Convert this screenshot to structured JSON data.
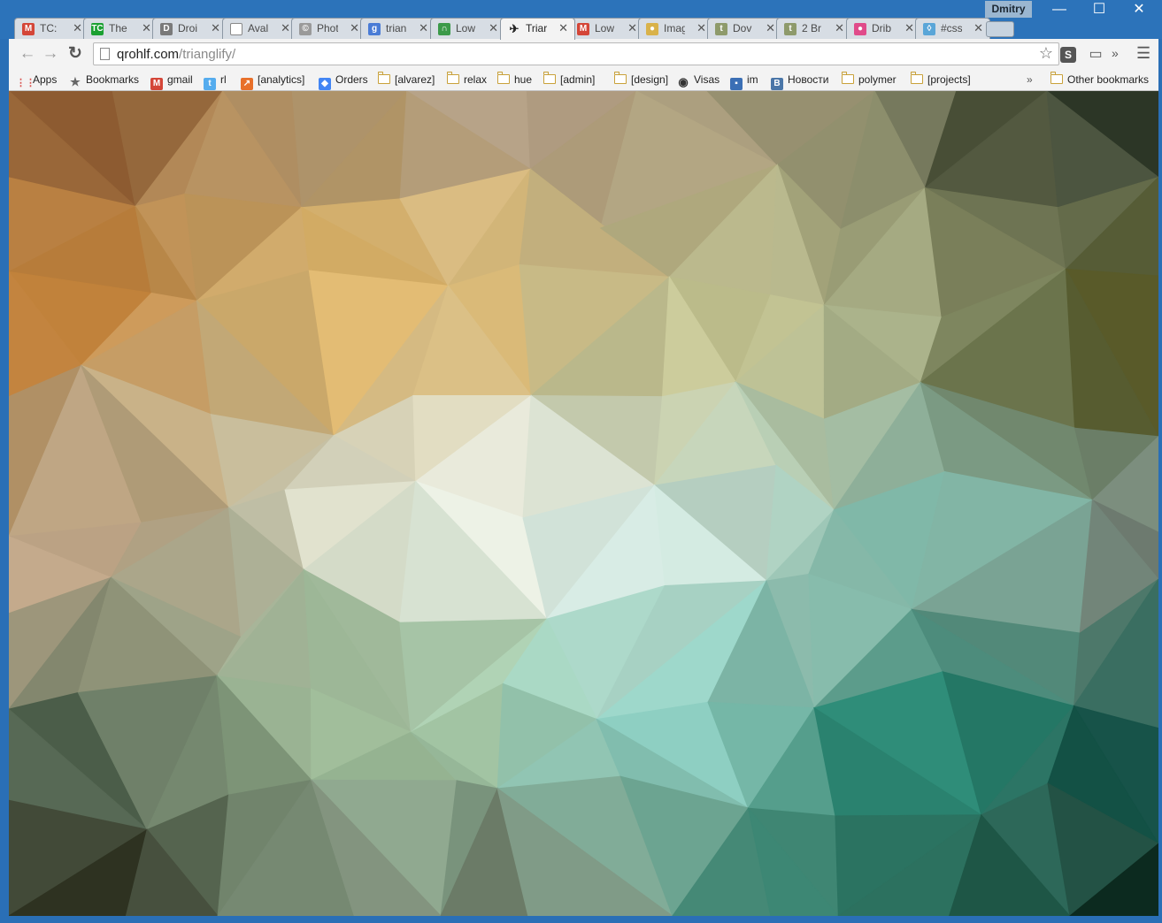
{
  "window": {
    "profile_name": "Dmitry",
    "minimize": "—",
    "maximize": "☐",
    "close": "✕"
  },
  "tabs": [
    {
      "title": "TC: ",
      "icon": "gmail-icon",
      "color": "#d44638",
      "glyph": "M"
    },
    {
      "title": "The",
      "icon": "techcrunch-icon",
      "color": "#1aa031",
      "glyph": "TC"
    },
    {
      "title": "Droi",
      "icon": "droid-icon",
      "color": "#7a7a7a",
      "glyph": "D"
    },
    {
      "title": "Aval",
      "icon": "page-icon",
      "color": "#ffffff",
      "glyph": ""
    },
    {
      "title": "Phot",
      "icon": "copyright-icon",
      "color": "#9a9a9a",
      "glyph": "©"
    },
    {
      "title": "trian",
      "icon": "google-icon",
      "color": "#4a7cd6",
      "glyph": "g"
    },
    {
      "title": "Low",
      "icon": "arch-icon",
      "color": "#3c9a4a",
      "glyph": "∩"
    },
    {
      "title": "Triar",
      "icon": "rocket-icon",
      "color": "#222222",
      "glyph": "✈"
    },
    {
      "title": "Low",
      "icon": "gmail-icon",
      "color": "#d44638",
      "glyph": "M"
    },
    {
      "title": "Imag",
      "icon": "dots-icon",
      "color": "#d9b24a",
      "glyph": "●"
    },
    {
      "title": "Dov",
      "icon": "shield-icon",
      "color": "#8e9a6b",
      "glyph": "t"
    },
    {
      "title": "2 Br",
      "icon": "shield-icon",
      "color": "#8e9a6b",
      "glyph": "t"
    },
    {
      "title": "Drib",
      "icon": "dribbble-icon",
      "color": "#e04b8a",
      "glyph": "●"
    },
    {
      "title": "#css",
      "icon": "drop-icon",
      "color": "#5aa6d8",
      "glyph": "◊"
    }
  ],
  "active_tab_index": 7,
  "toolbar": {
    "back": "←",
    "forward": "→",
    "reload": "↻",
    "url_host": "qrohlf.com",
    "url_path": "/trianglify/",
    "star": "☆",
    "extension_label": "S",
    "cast": "▭",
    "overflow": "»",
    "menu": "☰"
  },
  "bookmarks": {
    "items": [
      {
        "label": "Apps",
        "type": "apps"
      },
      {
        "label": "Bookmarks",
        "type": "star"
      },
      {
        "label": "gmail",
        "type": "gmail"
      },
      {
        "label": "rl",
        "type": "twitter"
      },
      {
        "label": "[analytics]",
        "type": "analytics"
      },
      {
        "label": "Orders",
        "type": "orders"
      },
      {
        "label": "[alvarez]",
        "type": "folder"
      },
      {
        "label": "relax",
        "type": "folder"
      },
      {
        "label": "hue",
        "type": "folder"
      },
      {
        "label": "[admin]",
        "type": "folder"
      },
      {
        "label": "[design]",
        "type": "folder"
      },
      {
        "label": "Visas",
        "type": "seal"
      },
      {
        "label": "im",
        "type": "chat"
      },
      {
        "label": "Новости",
        "type": "vk"
      },
      {
        "label": "polymer",
        "type": "folder"
      },
      {
        "label": "[projects]",
        "type": "folder"
      }
    ],
    "overflow": "»",
    "other": "Other bookmarks"
  },
  "colors": {
    "titlebar": "#2c73ba",
    "toolbar": "#f3f3f3",
    "accent_warm": "#e9b25c",
    "accent_light": "#f7f8f3",
    "accent_teal": "#3a9d8f",
    "accent_dark": "#0e3a2f"
  }
}
